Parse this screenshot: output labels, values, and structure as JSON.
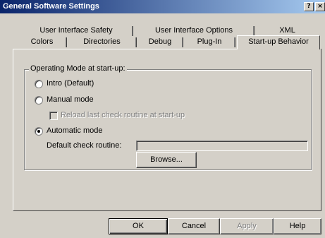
{
  "window": {
    "title": "General Software Settings",
    "help_glyph": "?",
    "close_glyph": "×"
  },
  "tabs": {
    "row_back": [
      {
        "label": "User Interface Safety"
      },
      {
        "label": "User Interface Options"
      },
      {
        "label": "XML"
      }
    ],
    "row_front": [
      {
        "label": "Colors"
      },
      {
        "label": "Directories"
      },
      {
        "label": "Debug"
      },
      {
        "label": "Plug-In"
      },
      {
        "label": "Start-up Behavior",
        "active": true
      }
    ]
  },
  "group": {
    "legend": "Operating Mode at start-up:",
    "options": [
      {
        "label": "Intro (Default)",
        "selected": false
      },
      {
        "label": "Manual mode",
        "selected": false
      },
      {
        "label": "Automatic mode",
        "selected": true
      }
    ],
    "reload_checkbox": {
      "label": "Reload last check routine at start-up",
      "checked": false,
      "disabled": true
    },
    "default_routine": {
      "label": "Default check routine:",
      "value": ""
    },
    "browse_label": "Browse..."
  },
  "footer": {
    "ok": "OK",
    "cancel": "Cancel",
    "apply": "Apply",
    "help": "Help"
  }
}
